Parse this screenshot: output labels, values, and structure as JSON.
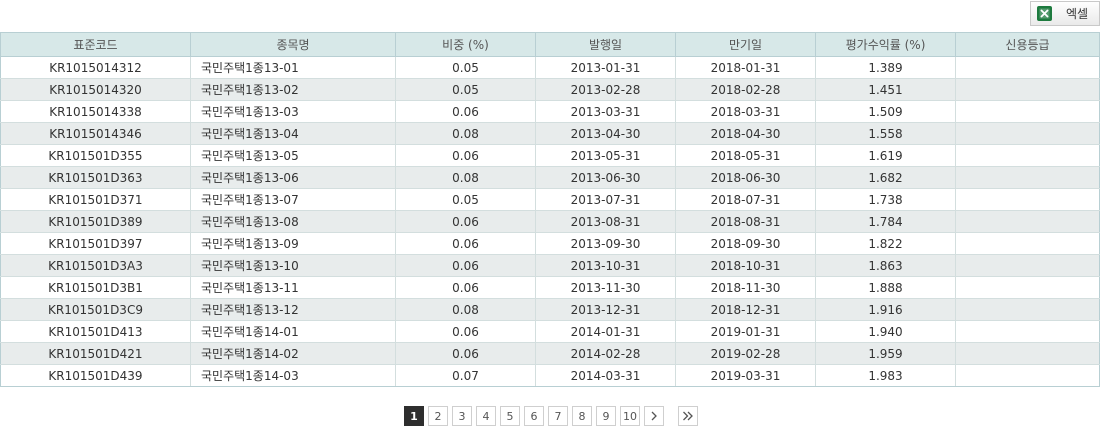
{
  "toolbar": {
    "excel_label": "엑셀",
    "excel_icon": "excel-icon"
  },
  "table": {
    "headers": [
      "표준코드",
      "종목명",
      "비중 (%)",
      "발행일",
      "만기일",
      "평가수익률 (%)",
      "신용등급"
    ],
    "rows": [
      [
        "KR1015014312",
        "국민주택1종13-01",
        "0.05",
        "2013-01-31",
        "2018-01-31",
        "1.389",
        ""
      ],
      [
        "KR1015014320",
        "국민주택1종13-02",
        "0.05",
        "2013-02-28",
        "2018-02-28",
        "1.451",
        ""
      ],
      [
        "KR1015014338",
        "국민주택1종13-03",
        "0.06",
        "2013-03-31",
        "2018-03-31",
        "1.509",
        ""
      ],
      [
        "KR1015014346",
        "국민주택1종13-04",
        "0.08",
        "2013-04-30",
        "2018-04-30",
        "1.558",
        ""
      ],
      [
        "KR101501D355",
        "국민주택1종13-05",
        "0.06",
        "2013-05-31",
        "2018-05-31",
        "1.619",
        ""
      ],
      [
        "KR101501D363",
        "국민주택1종13-06",
        "0.08",
        "2013-06-30",
        "2018-06-30",
        "1.682",
        ""
      ],
      [
        "KR101501D371",
        "국민주택1종13-07",
        "0.05",
        "2013-07-31",
        "2018-07-31",
        "1.738",
        ""
      ],
      [
        "KR101501D389",
        "국민주택1종13-08",
        "0.06",
        "2013-08-31",
        "2018-08-31",
        "1.784",
        ""
      ],
      [
        "KR101501D397",
        "국민주택1종13-09",
        "0.06",
        "2013-09-30",
        "2018-09-30",
        "1.822",
        ""
      ],
      [
        "KR101501D3A3",
        "국민주택1종13-10",
        "0.06",
        "2013-10-31",
        "2018-10-31",
        "1.863",
        ""
      ],
      [
        "KR101501D3B1",
        "국민주택1종13-11",
        "0.06",
        "2013-11-30",
        "2018-11-30",
        "1.888",
        ""
      ],
      [
        "KR101501D3C9",
        "국민주택1종13-12",
        "0.08",
        "2013-12-31",
        "2018-12-31",
        "1.916",
        ""
      ],
      [
        "KR101501D413",
        "국민주택1종14-01",
        "0.06",
        "2014-01-31",
        "2019-01-31",
        "1.940",
        ""
      ],
      [
        "KR101501D421",
        "국민주택1종14-02",
        "0.06",
        "2014-02-28",
        "2019-02-28",
        "1.959",
        ""
      ],
      [
        "KR101501D439",
        "국민주택1종14-03",
        "0.07",
        "2014-03-31",
        "2019-03-31",
        "1.983",
        ""
      ]
    ]
  },
  "pagination": {
    "pages": [
      "1",
      "2",
      "3",
      "4",
      "5",
      "6",
      "7",
      "8",
      "9",
      "10"
    ],
    "current": "1",
    "next_icon": "chevron-right-icon",
    "last_icon": "double-chevron-right-icon"
  }
}
